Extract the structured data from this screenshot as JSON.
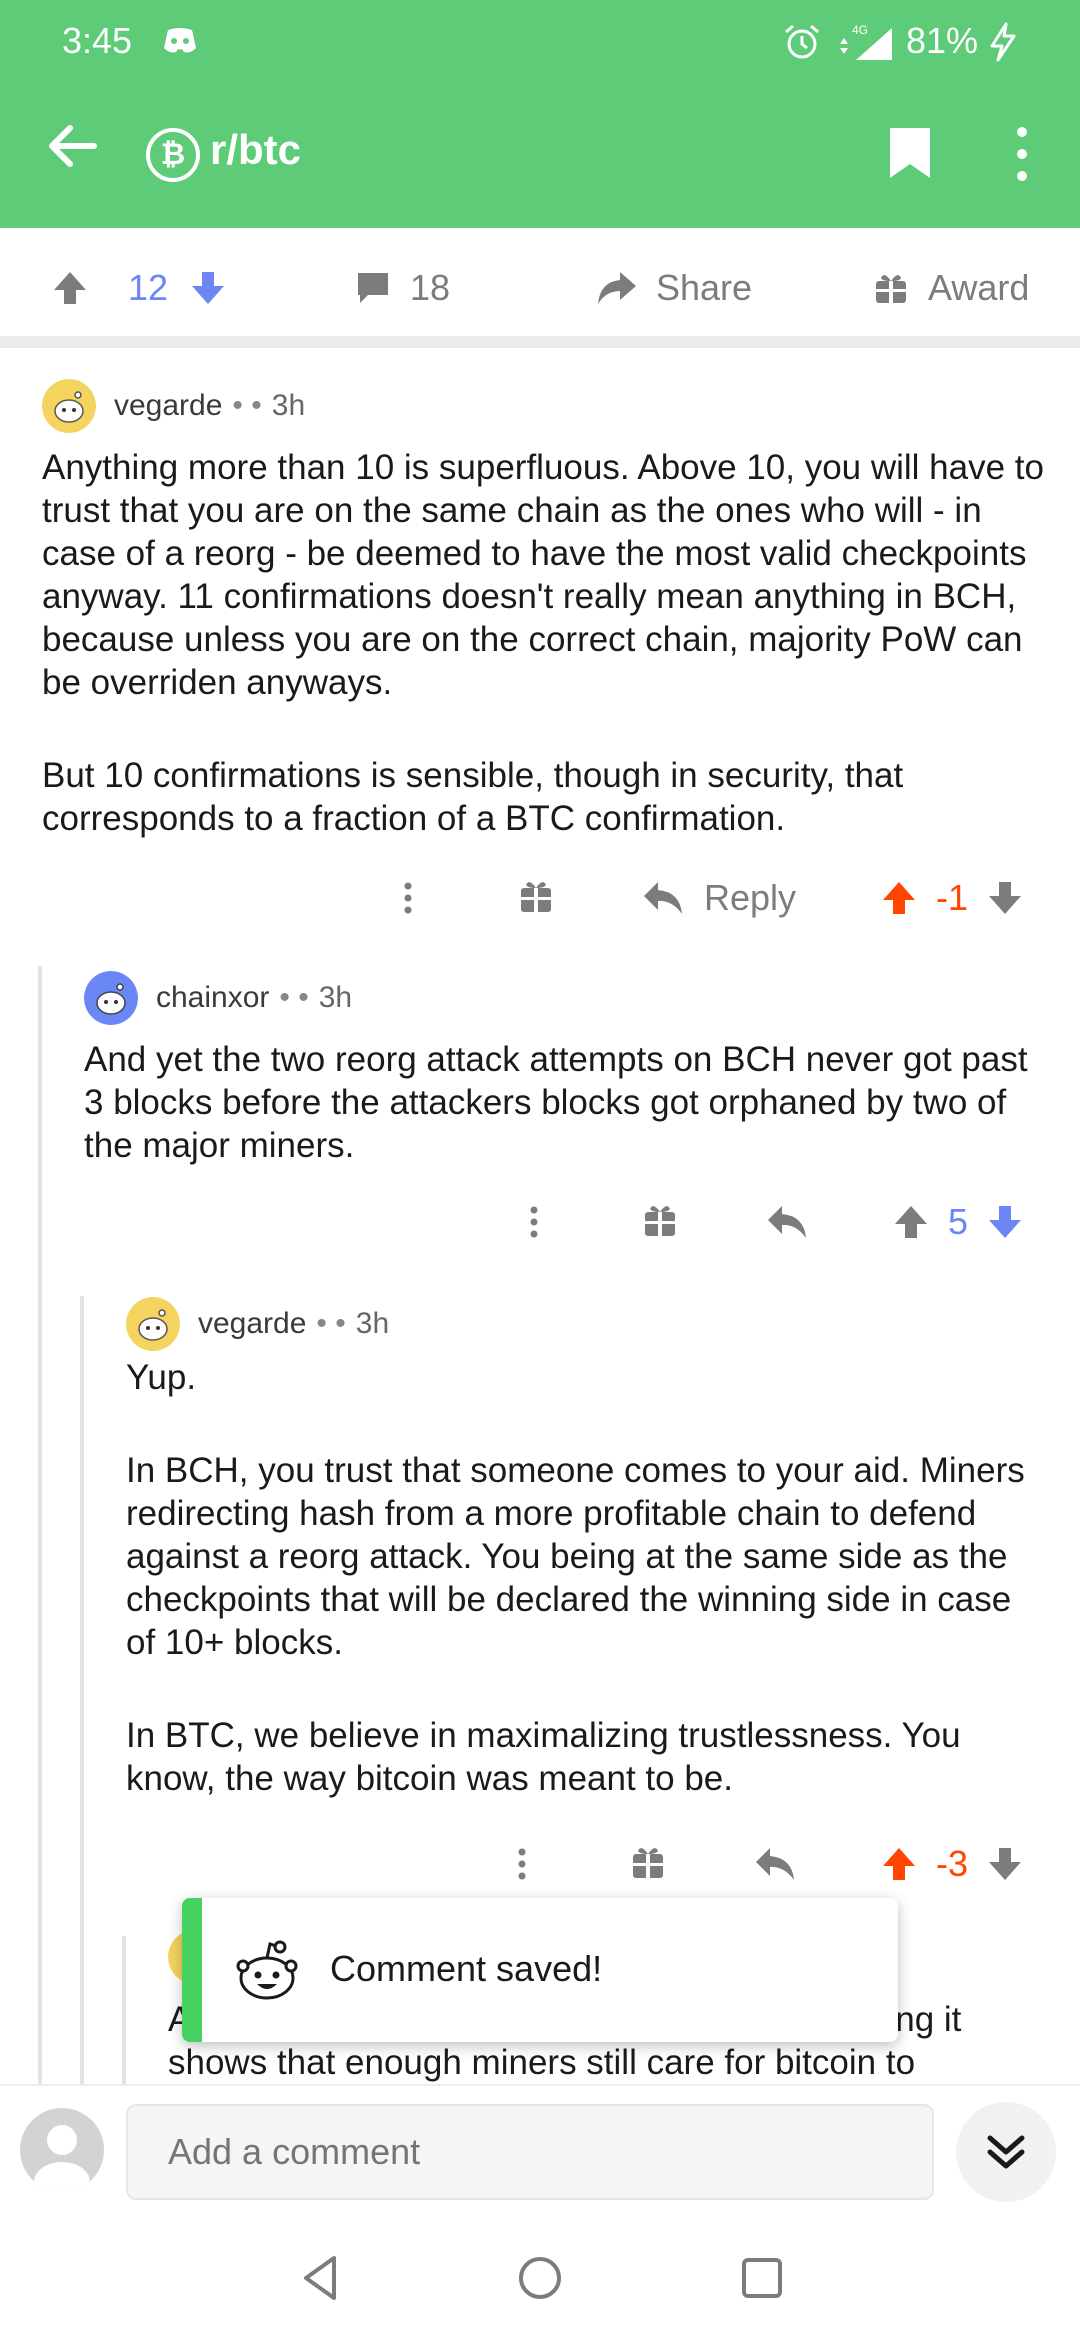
{
  "status": {
    "time": "3:45",
    "network": "4G",
    "battery": "81%"
  },
  "header": {
    "subreddit_icon": "₿",
    "subreddit": "r/btc"
  },
  "post_bar": {
    "score": "12",
    "comments": "18",
    "share_label": "Share",
    "award_label": "Award"
  },
  "comments": [
    {
      "author": "vegarde",
      "age": "3h",
      "paragraphs": [
        "Anything more than 10 is superfluous. Above 10, you will have to trust that you are on the same chain as the ones who will - in case of a reorg - be deemed to have the most valid checkpoints anyway. 11 confirmations doesn't really mean anything in BCH, because unless you are on the correct chain, majority PoW can be overriden anyways.",
        "But 10 confirmations is sensible, though in security, that corresponds to a fraction of a BTC confirmation."
      ],
      "reply_label": "Reply",
      "score": "-1"
    },
    {
      "author": "chainxor",
      "age": "3h",
      "paragraphs": [
        "And yet the two reorg attack attempts on BCH never got past 3 blocks before the attackers blocks got orphaned by two of the major miners."
      ],
      "score": "5"
    },
    {
      "author": "vegarde",
      "age": "3h",
      "paragraphs": [
        "Yup.",
        "In BCH, you trust that someone comes to your aid. Miners redirecting hash from a more profitable chain to defend against a reorg attack. You being at the same side as the checkpoints that will be declared the winning side in case of 10+ blocks.",
        "In BTC, we believe in maximalizing trustlessness. You know, the way bitcoin was meant to be."
      ],
      "score": "-3"
    },
    {
      "partial_line1_start": "A",
      "partial_line1_end": "hing it",
      "partial_line2": "shows that enough miners still care for bitcoin to"
    }
  ],
  "toast": {
    "message": "Comment saved!"
  },
  "composer": {
    "placeholder": "Add a comment"
  },
  "colors": {
    "brand_green": "#5ecb79",
    "upvote_orange": "#ff4500",
    "downvote_blue": "#6b86f5",
    "toast_accent": "#46d160"
  }
}
